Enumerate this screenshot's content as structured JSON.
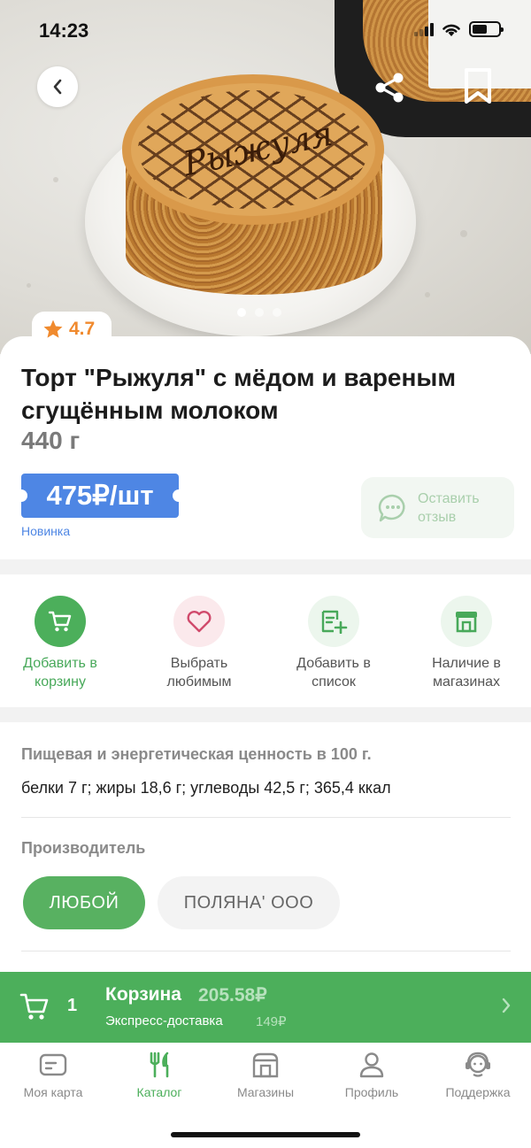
{
  "status_bar": {
    "time": "14:23"
  },
  "header": {
    "back_icon": "chevron-left-icon",
    "share_icon": "share-icon",
    "bookmark_icon": "bookmark-icon"
  },
  "gallery": {
    "pages": 3,
    "current_page": 1
  },
  "product": {
    "rating": "4.7",
    "title": "Торт \"Рыжуля\" с мёдом и вареным сгущённым молоком",
    "weight": "440 г",
    "price": "475₽/шт",
    "badge": "Новинка",
    "review_button_label": "Оставить отзыв"
  },
  "actions": [
    {
      "label": "Добавить в корзину",
      "icon": "cart-icon"
    },
    {
      "label": "Выбрать любимым",
      "icon": "heart-icon"
    },
    {
      "label": "Добавить в список",
      "icon": "list-add-icon"
    },
    {
      "label": "Наличие в магазинах",
      "icon": "store-icon"
    }
  ],
  "nutrition": {
    "heading": "Пищевая и энергетическая ценность в 100 г.",
    "values": "белки 7 г; жиры 18,6 г; углеводы 42,5 г; 365,4 ккал"
  },
  "manufacturer": {
    "heading": "Производитель",
    "options": [
      "ЛЮБОЙ",
      "ПОЛЯНА' ООО"
    ],
    "selected": "ЛЮБОЙ"
  },
  "cart_bar": {
    "count": "1",
    "title": "Корзина",
    "total": "205.58₽",
    "delivery_label": "Экспресс-доставка",
    "delivery_price": "149₽"
  },
  "tabbar": [
    {
      "label": "Моя карта",
      "icon": "card-icon"
    },
    {
      "label": "Каталог",
      "icon": "fork-knife-icon"
    },
    {
      "label": "Магазины",
      "icon": "store-icon"
    },
    {
      "label": "Профиль",
      "icon": "profile-icon"
    },
    {
      "label": "Поддержка",
      "icon": "support-icon"
    }
  ],
  "colors": {
    "brand_green": "#4caf5b",
    "price_blue": "#4e86e4",
    "rating_orange": "#f08a2e"
  }
}
